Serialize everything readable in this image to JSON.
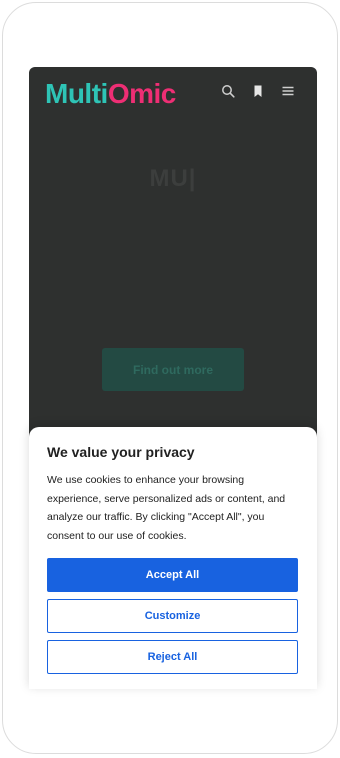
{
  "site": {
    "logo_part1": "Multi",
    "logo_part2": "Omic",
    "icons": [
      "search-icon",
      "bookmark-icon",
      "menu-icon"
    ],
    "colors": {
      "teal": "#2ec4b6",
      "pink": "#ee2e74",
      "background": "#2e302f"
    }
  },
  "hero": {
    "title": "MU|",
    "text": "",
    "cta_label": "Find out more"
  },
  "consent": {
    "title": "We value your privacy",
    "body": "We use cookies to enhance your browsing experience, serve personalized ads or content, and analyze our traffic. By clicking \"Accept All\", you consent to our use of cookies.",
    "accept_label": "Accept All",
    "customize_label": "Customize",
    "reject_label": "Reject All",
    "accent_color": "#1862e0"
  }
}
